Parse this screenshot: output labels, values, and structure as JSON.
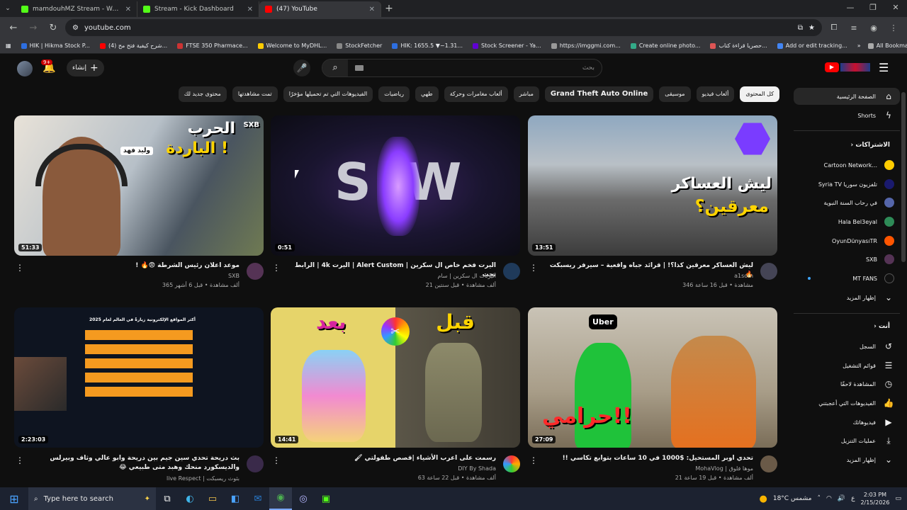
{
  "browser": {
    "tabs": [
      {
        "title": "mamdouhMZ Stream - Watch L",
        "color": "#53fc18",
        "active": false
      },
      {
        "title": "Stream - Kick Dashboard",
        "color": "#53fc18",
        "active": false
      },
      {
        "title": "(47) YouTube",
        "color": "#ff0000",
        "active": true
      }
    ],
    "url": "youtube.com",
    "bookmarks": [
      "HIK | Hikma Stock P...",
      "(4) شرح كيفية فتح مح...",
      "FTSE 350 Pharmace...",
      "Welcome to MyDHL...",
      "StockFetcher",
      "HIK: 1655.5 ▼−1.31...",
      "Stock Screener - Ya...",
      "https://imggmi.com...",
      "Create online photo...",
      "حصريا قراءة كتاب...",
      "Add or edit tracking..."
    ],
    "all_bookmarks": "All Bookmarks"
  },
  "header": {
    "badge": "9+",
    "create_label": "إنشاء",
    "search_placeholder": "بحث"
  },
  "chips": [
    {
      "label": "كل المحتوى",
      "selected": true
    },
    {
      "label": "ألعاب فيديو"
    },
    {
      "label": "موسيقى"
    },
    {
      "label": "Grand Theft Auto Online",
      "big": true
    },
    {
      "label": "مباشر"
    },
    {
      "label": "ألعاب مغامرات وحركة"
    },
    {
      "label": "طهي"
    },
    {
      "label": "رياضيات"
    },
    {
      "label": "الفيديوهات التي تم تحميلها مؤخرًا"
    },
    {
      "label": "تمت مشاهدتها"
    },
    {
      "label": "محتوى جديد لك"
    }
  ],
  "videos": [
    {
      "title": "موعد اعلان رئيس الشرطة 😨🔥 !",
      "channel": "SXB",
      "stats": "365 ألف مشاهدة • قبل 6 أشهر",
      "duration": "51:33",
      "thumb_text": [
        "الحرب",
        "الباردة !",
        "وليد فهد"
      ]
    },
    {
      "title": "اليرت فخم خاص ال سكرين | Alert Custom | اليرت 4k | الرابط تحت",
      "channel": "اليرتات ال سكرين | سام",
      "stats": "21 ألف مشاهدة • قبل سنتين",
      "duration": "0:51",
      "thumb_text": [
        "S",
        "W"
      ]
    },
    {
      "title": "ليش العساكر معرقين كذا؟! | قرائد جباه واقعية – سيرفر ريسبكت 🔥",
      "channel": "a1som",
      "stats": "346 مشاهدة • قبل 16 ساعة",
      "duration": "13:51",
      "thumb_text": [
        "ليش العساكر",
        "معرقين؟"
      ]
    },
    {
      "title": "بث دريحة تحدي سين جيم بين دريحة وابو عالي وثاف وبيرلس والديسكورد منحك وهبد متى طبيعي 😂",
      "channel": "live Respect | بثوث ريسبكت",
      "stats": "",
      "duration": "2:23:03",
      "thumb_text": [
        "أكثر المواقع الإلكترونية زيارةً في العالم لعام 2025"
      ]
    },
    {
      "title": "رسمت على اعرب الأشياء |قصص طفولتي 🖌",
      "channel": "DIY By Shada",
      "stats": "63 ألف مشاهدة • قبل 22 ساعة",
      "duration": "14:41",
      "thumb_text": [
        "بعد",
        "قبل"
      ]
    },
    {
      "title": "تحدي اوبر المستحيل: $1000 في 10 ساعات بتوابع تكاسي !!",
      "channel": "MohaVlog | موها فلوق",
      "stats": "21 ألف مشاهدة • قبل 19 ساعة",
      "duration": "27:09",
      "thumb_text": [
        "حرامي!!",
        "Uber"
      ]
    }
  ],
  "sidebar": {
    "home": "الصفحة الرئيسية",
    "shorts": "Shorts",
    "subs_head": "الاشتراكات",
    "subscriptions": [
      {
        "name": "Cartoon Network...",
        "color": "#ffcc00",
        "live": true
      },
      {
        "name": "Syria TV تلفزيون سوريا",
        "color": "#1a1a6e",
        "live": true
      },
      {
        "name": "في رحاب السنة النبوية",
        "color": "#5566aa",
        "live": true
      },
      {
        "name": "Hala Bel3eyal",
        "color": "#2e8b57",
        "live": true
      },
      {
        "name": "OyunDünyasıTR",
        "color": "#ff5500",
        "live": true
      },
      {
        "name": "SXB",
        "color": "#553355",
        "live": false
      },
      {
        "name": "MT FANS",
        "color": "#111111",
        "live": true
      }
    ],
    "show_more": "إظهار المزيد",
    "you_head": "أنت",
    "you_items": [
      {
        "label": "السجل",
        "icon": "↺"
      },
      {
        "label": "قوائم التشغيل",
        "icon": "☰"
      },
      {
        "label": "المشاهدة لاحقًا",
        "icon": "◷"
      },
      {
        "label": "الفيديوهات التي أعجبتني",
        "icon": "👍"
      },
      {
        "label": "فيديوهاتك",
        "icon": "▶"
      },
      {
        "label": "عمليات التنزيل",
        "icon": "⤓"
      },
      {
        "label": "إظهار المزيد",
        "icon": "⌄"
      }
    ]
  },
  "taskbar": {
    "search": "Type here to search",
    "weather": "18°C مشمس",
    "time": "2:03 PM",
    "date": "2/15/2026",
    "lang": "ع"
  }
}
